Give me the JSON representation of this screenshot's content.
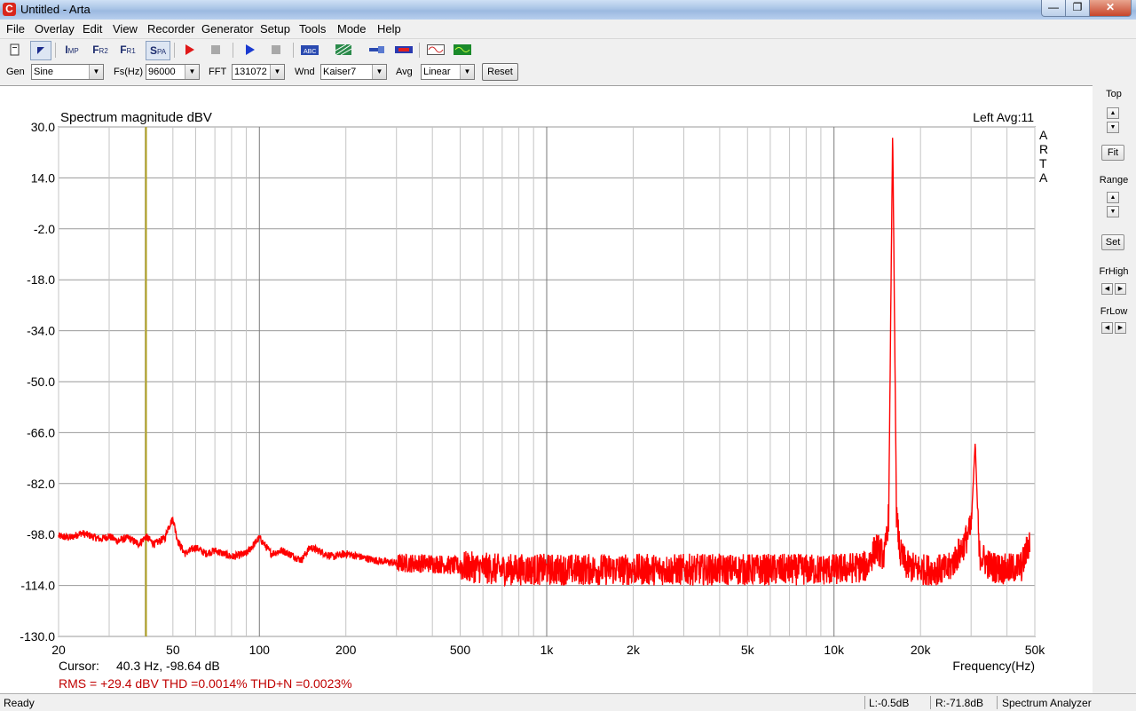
{
  "window": {
    "title": "Untitled - Arta"
  },
  "menu": [
    "File",
    "Overlay",
    "Edit",
    "View",
    "Recorder",
    "Generator",
    "Setup",
    "Tools",
    "Mode",
    "Help"
  ],
  "toolbar": {
    "buttons": [
      "new-file",
      "pointer",
      "Imp",
      "Fr2",
      "Fr1",
      "Spa",
      "record",
      "stop",
      "play",
      "stop",
      "abc",
      "grid",
      "probe",
      "signal",
      "sine-gen",
      "wave-gen"
    ],
    "imp_label": "I",
    "imp_sub": "MP",
    "fr2_label": "F",
    "fr2_sub": "R2",
    "fr1_label": "F",
    "fr1_sub": "R1",
    "spa_label": "S",
    "spa_sub": "PA"
  },
  "params": {
    "gen_label": "Gen",
    "gen_value": "Sine",
    "fs_label": "Fs(Hz)",
    "fs_value": "96000",
    "fft_label": "FFT",
    "fft_value": "131072",
    "wnd_label": "Wnd",
    "wnd_value": "Kaiser7",
    "avg_label": "Avg",
    "avg_value": "Linear",
    "reset_label": "Reset"
  },
  "right_panel": {
    "top_label": "Top",
    "fit_label": "Fit",
    "range_label": "Range",
    "set_label": "Set",
    "frhigh_label": "FrHigh",
    "frlow_label": "FrLow"
  },
  "graph": {
    "title": "Spectrum magnitude dBV",
    "channel_info": "Left  Avg:11",
    "watermark": [
      "A",
      "R",
      "T",
      "A"
    ],
    "cursor_label": "Cursor:",
    "cursor_value": "40.3 Hz, -98.64 dB",
    "measurements": "RMS =  +29.4 dBV   THD =0.0014%   THD+N =0.0023%",
    "xlabel": "Frequency(Hz)"
  },
  "status": {
    "ready": "Ready",
    "left_level": "L:-0.5dB",
    "right_level": "R:-71.8dB",
    "mode": "Spectrum Analyzer"
  },
  "colors": {
    "trace": "#ff0000",
    "cursor": "#b0a020",
    "measurements": "#c00000"
  },
  "chart_data": {
    "type": "line",
    "title": "Spectrum magnitude dBV",
    "xlabel": "Frequency(Hz)",
    "ylabel": "",
    "x_scale": "log",
    "xlim": [
      20,
      50000
    ],
    "ylim": [
      -130,
      30
    ],
    "x_ticks": [
      20,
      50,
      100,
      200,
      500,
      1000,
      2000,
      5000,
      10000,
      20000,
      50000
    ],
    "x_tick_labels": [
      "20",
      "50",
      "100",
      "200",
      "500",
      "1k",
      "2k",
      "5k",
      "10k",
      "20k",
      "50k"
    ],
    "y_ticks": [
      30.0,
      14.0,
      -2.0,
      -18.0,
      -34.0,
      -50.0,
      -66.0,
      -82.0,
      -98.0,
      -114.0,
      -130.0
    ],
    "y_tick_labels": [
      "30.0",
      "14.0",
      "-2.0",
      "-18.0",
      "-34.0",
      "-50.0",
      "-66.0",
      "-82.0",
      "-98.0",
      "-114.0",
      "-130.0"
    ],
    "grid": true,
    "cursor_x": 40.3,
    "series": [
      {
        "x": [
          20,
          22,
          24,
          26,
          28,
          30,
          32,
          35,
          38,
          40.3,
          43,
          45,
          47,
          48,
          50,
          52,
          55,
          60,
          65,
          70,
          80,
          90,
          100,
          110,
          120,
          140,
          150,
          160,
          180,
          200,
          250,
          300,
          400,
          500,
          700,
          1000,
          2000,
          5000,
          10000,
          13000,
          14000,
          15000,
          15500,
          16000,
          16500,
          17000,
          18000,
          20000,
          25000,
          28000,
          30000,
          31000,
          32000,
          35000,
          40000,
          45000,
          48000
        ],
        "y": [
          -98.5,
          -99,
          -97.5,
          -98.5,
          -99.5,
          -98.5,
          -100,
          -99,
          -101,
          -98.6,
          -101,
          -100,
          -99,
          -96,
          -93,
          -100,
          -104,
          -102,
          -104,
          -103,
          -105,
          -104,
          -99,
          -104,
          -103,
          -106,
          -102,
          -103,
          -105,
          -104,
          -106,
          -107,
          -107,
          -108,
          -109,
          -109,
          -109,
          -109,
          -109,
          -108,
          -102,
          -105,
          -92,
          29.5,
          -92,
          -104,
          -108,
          -109,
          -109,
          -102,
          -96,
          -69,
          -104,
          -108,
          -109,
          -108,
          -100
        ]
      }
    ]
  }
}
